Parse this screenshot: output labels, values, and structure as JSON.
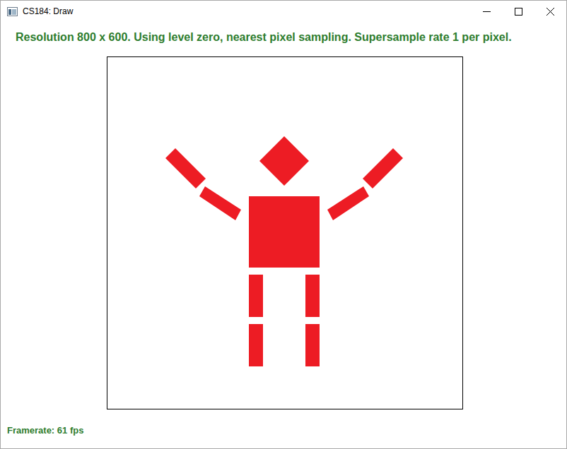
{
  "window": {
    "title": "CS184: Draw"
  },
  "info": {
    "text": "Resolution 800 x 600. Using level zero, nearest pixel sampling. Supersample rate 1 per pixel."
  },
  "status_bar": {
    "framerate": "Framerate: 61 fps"
  }
}
